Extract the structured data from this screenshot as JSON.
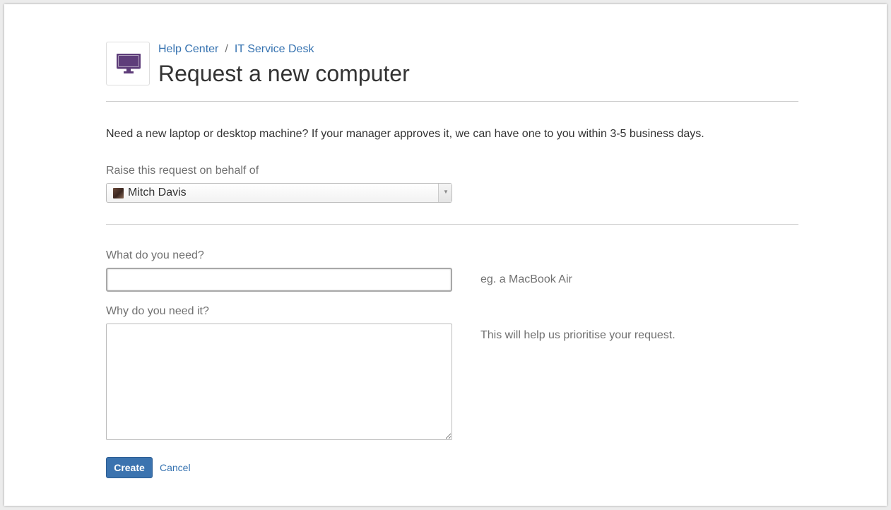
{
  "header": {
    "breadcrumb": [
      {
        "label": "Help Center"
      },
      {
        "label": "IT Service Desk"
      }
    ],
    "separator": "/",
    "title": "Request a new computer",
    "icon": "monitor-icon",
    "icon_color": "#5e3d7a"
  },
  "intro": "Need a new laptop or desktop machine? If your manager approves it, we can have one to you within 3-5 business days.",
  "on_behalf": {
    "label": "Raise this request on behalf of",
    "selected": "Mitch Davis"
  },
  "fields": {
    "need": {
      "label": "What do you need?",
      "value": "",
      "help": "eg. a MacBook Air"
    },
    "reason": {
      "label": "Why do you need it?",
      "value": "",
      "help": "This will help us prioritise your request."
    }
  },
  "actions": {
    "create_label": "Create",
    "cancel_label": "Cancel"
  },
  "colors": {
    "link": "#3572b0",
    "primary_button": "#3b73af"
  }
}
